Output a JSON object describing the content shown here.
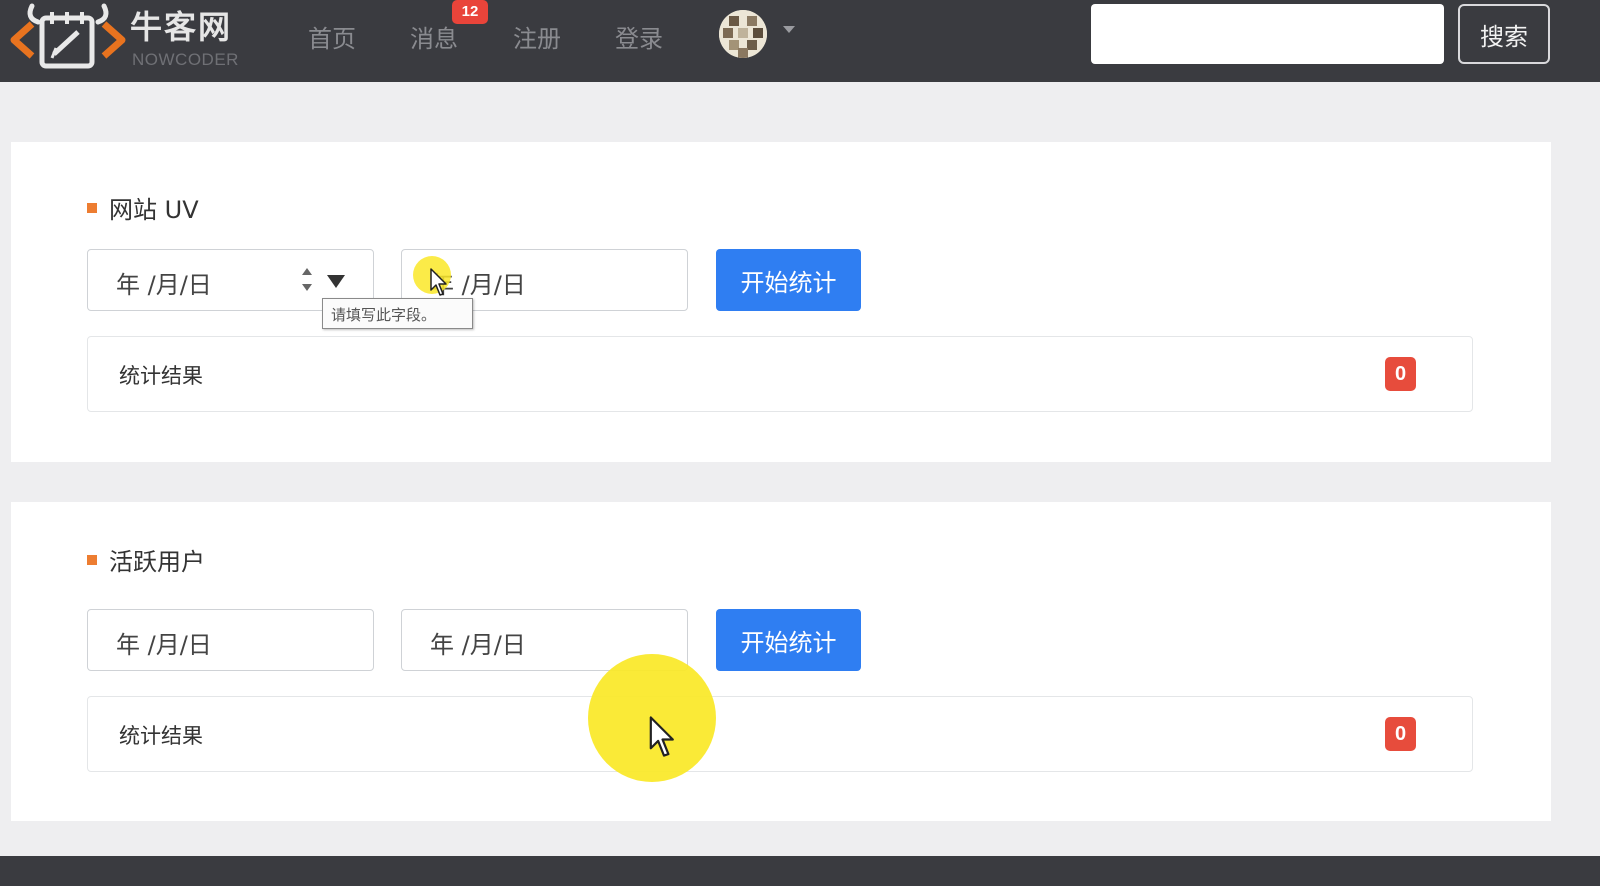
{
  "header": {
    "logo_cn": "牛客网",
    "logo_en": "NOWCODER",
    "nav": {
      "home": "首页",
      "messages": "消息",
      "register": "注册",
      "login": "登录"
    },
    "message_badge": "12",
    "search": {
      "value": "",
      "placeholder": "",
      "button_label": "搜索"
    }
  },
  "uv_section": {
    "title": "网站 UV",
    "start_date_placeholder": "年 /月/日",
    "end_date_placeholder": "年 /月/日",
    "start_button": "开始统计",
    "result_label": "统计结果",
    "result_value": "0",
    "tooltip": "请填写此字段。"
  },
  "active_section": {
    "title": "活跃用户",
    "start_date_placeholder": "年 /月/日",
    "end_date_placeholder": "年 /月/日",
    "start_button": "开始统计",
    "result_label": "统计结果",
    "result_value": "0"
  },
  "colors": {
    "header_bg": "#3a3b40",
    "accent_blue": "#2f7ef2",
    "badge_red": "#e74c3c",
    "title_marker": "#ed7d31",
    "highlight_yellow": "#fae828"
  },
  "icons": [
    "logo-icon",
    "avatar",
    "caret-down-icon",
    "spin-up-icon",
    "spin-down-icon",
    "calendar-dropdown-icon",
    "mouse-cursor-icon"
  ]
}
